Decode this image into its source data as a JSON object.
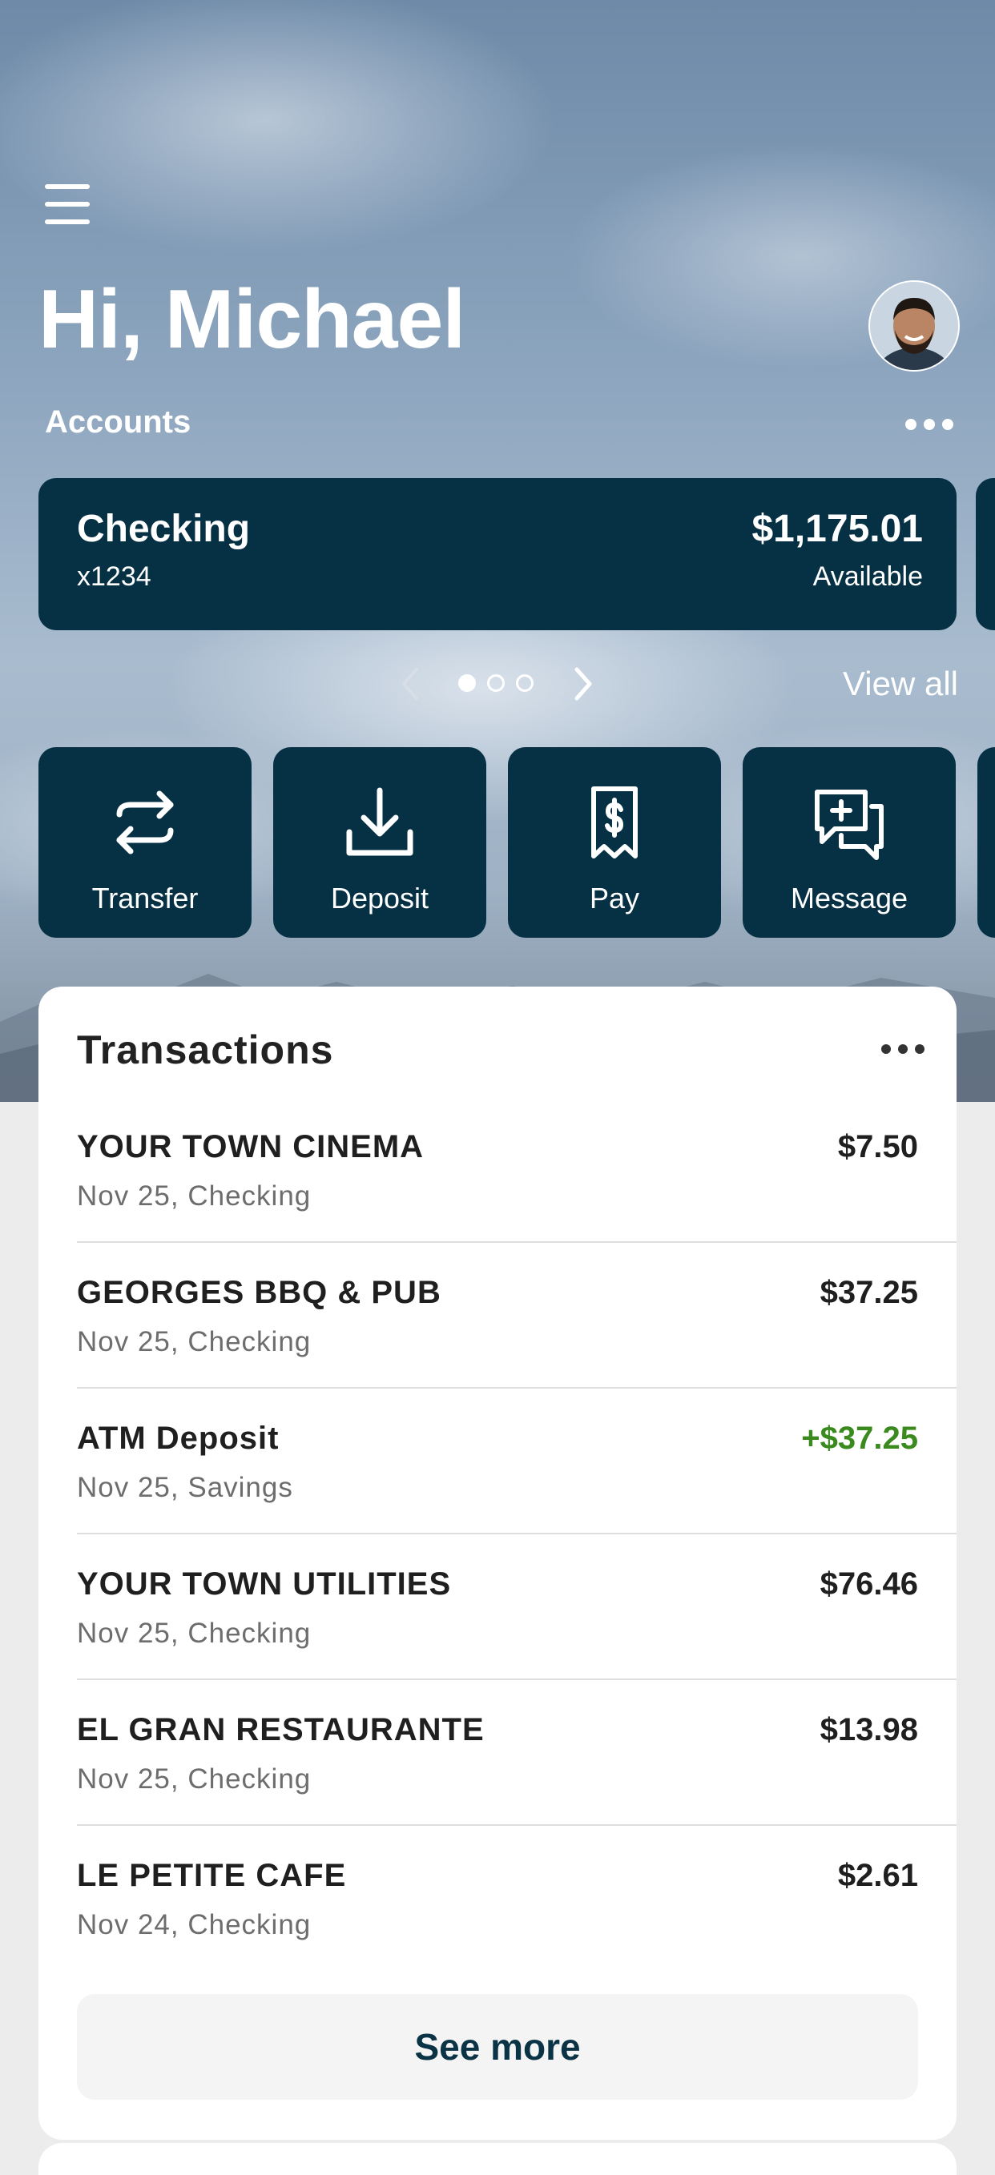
{
  "header": {
    "greeting": "Hi, Michael",
    "accounts_label": "Accounts"
  },
  "accounts": [
    {
      "name": "Checking",
      "number": "x1234",
      "balance": "$1,175.01",
      "balance_label": "Available"
    }
  ],
  "carousel": {
    "active_index": 0,
    "page_count": 3,
    "view_all_label": "View all"
  },
  "actions": [
    {
      "label": "Transfer",
      "icon": "transfer-icon"
    },
    {
      "label": "Deposit",
      "icon": "deposit-icon"
    },
    {
      "label": "Pay",
      "icon": "pay-bill-icon"
    },
    {
      "label": "Message",
      "icon": "message-icon"
    }
  ],
  "transactions": {
    "title": "Transactions",
    "items": [
      {
        "name": "YOUR TOWN CINEMA",
        "details": "Nov 25, Checking",
        "amount": "$7.50",
        "credit": false
      },
      {
        "name": "GEORGES BBQ & PUB",
        "details": "Nov 25, Checking",
        "amount": "$37.25",
        "credit": false
      },
      {
        "name": "ATM Deposit",
        "details": "Nov 25, Savings",
        "amount": "+$37.25",
        "credit": true
      },
      {
        "name": "YOUR TOWN UTILITIES",
        "details": "Nov 25, Checking",
        "amount": "$76.46",
        "credit": false
      },
      {
        "name": "EL GRAN RESTAURANTE",
        "details": "Nov 25, Checking",
        "amount": "$13.98",
        "credit": false
      },
      {
        "name": "LE PETITE CAFE",
        "details": "Nov 24, Checking",
        "amount": "$2.61",
        "credit": false
      }
    ],
    "see_more_label": "See more"
  },
  "colors": {
    "card_navy": "#063044",
    "credit_green": "#3a8a1e",
    "see_more_text": "#0b3346"
  }
}
